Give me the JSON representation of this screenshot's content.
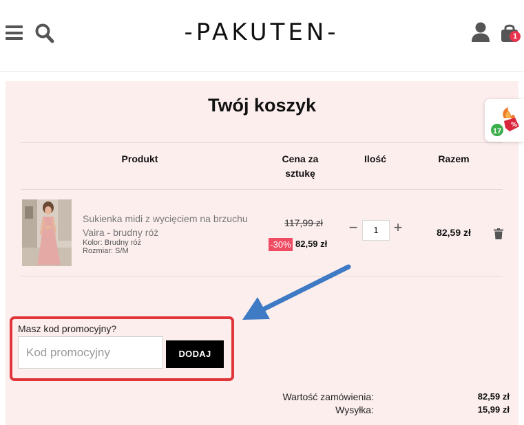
{
  "header": {
    "logo": "-PAKUTEN-",
    "cart_count": "1",
    "icons": [
      "hamburger-menu-icon",
      "search-icon",
      "user-icon",
      "shopping-bag-icon"
    ]
  },
  "cart": {
    "title": "Twój koszyk",
    "columns": {
      "product": "Produkt",
      "price_line1": "Cena za",
      "price_line2": "sztukę",
      "quantity": "Ilość",
      "total": "Razem"
    },
    "item": {
      "name": "Sukienka midi z wycięciem na brzuchu Vaira - brudny róż",
      "color": "Kolor: Brudny róż",
      "size": "Rozmiar: S/M",
      "old_price": "117,99 zł",
      "discount": "-30%",
      "price": "82,59 zł",
      "quantity": "1",
      "quantity_minus": "−",
      "quantity_plus": "+",
      "total": "82,59 zł"
    },
    "promo": {
      "label": "Masz kod promocyjny?",
      "placeholder": "Kod promocyjny",
      "button": "DODAJ"
    },
    "summary": {
      "order_value_label": "Wartość zamówienia:",
      "order_value": "82,59 zł",
      "shipping_label": "Wysyłka:",
      "shipping": "15,99 zł"
    }
  },
  "widget": {
    "count": "17",
    "icon": "discount-offer-icon"
  },
  "colors": {
    "cart_background": "#fdeeee",
    "discount_badge": "#ef4b63",
    "highlight_border": "#e0363a",
    "arrow": "#3f7bc4",
    "button": "#000000"
  }
}
